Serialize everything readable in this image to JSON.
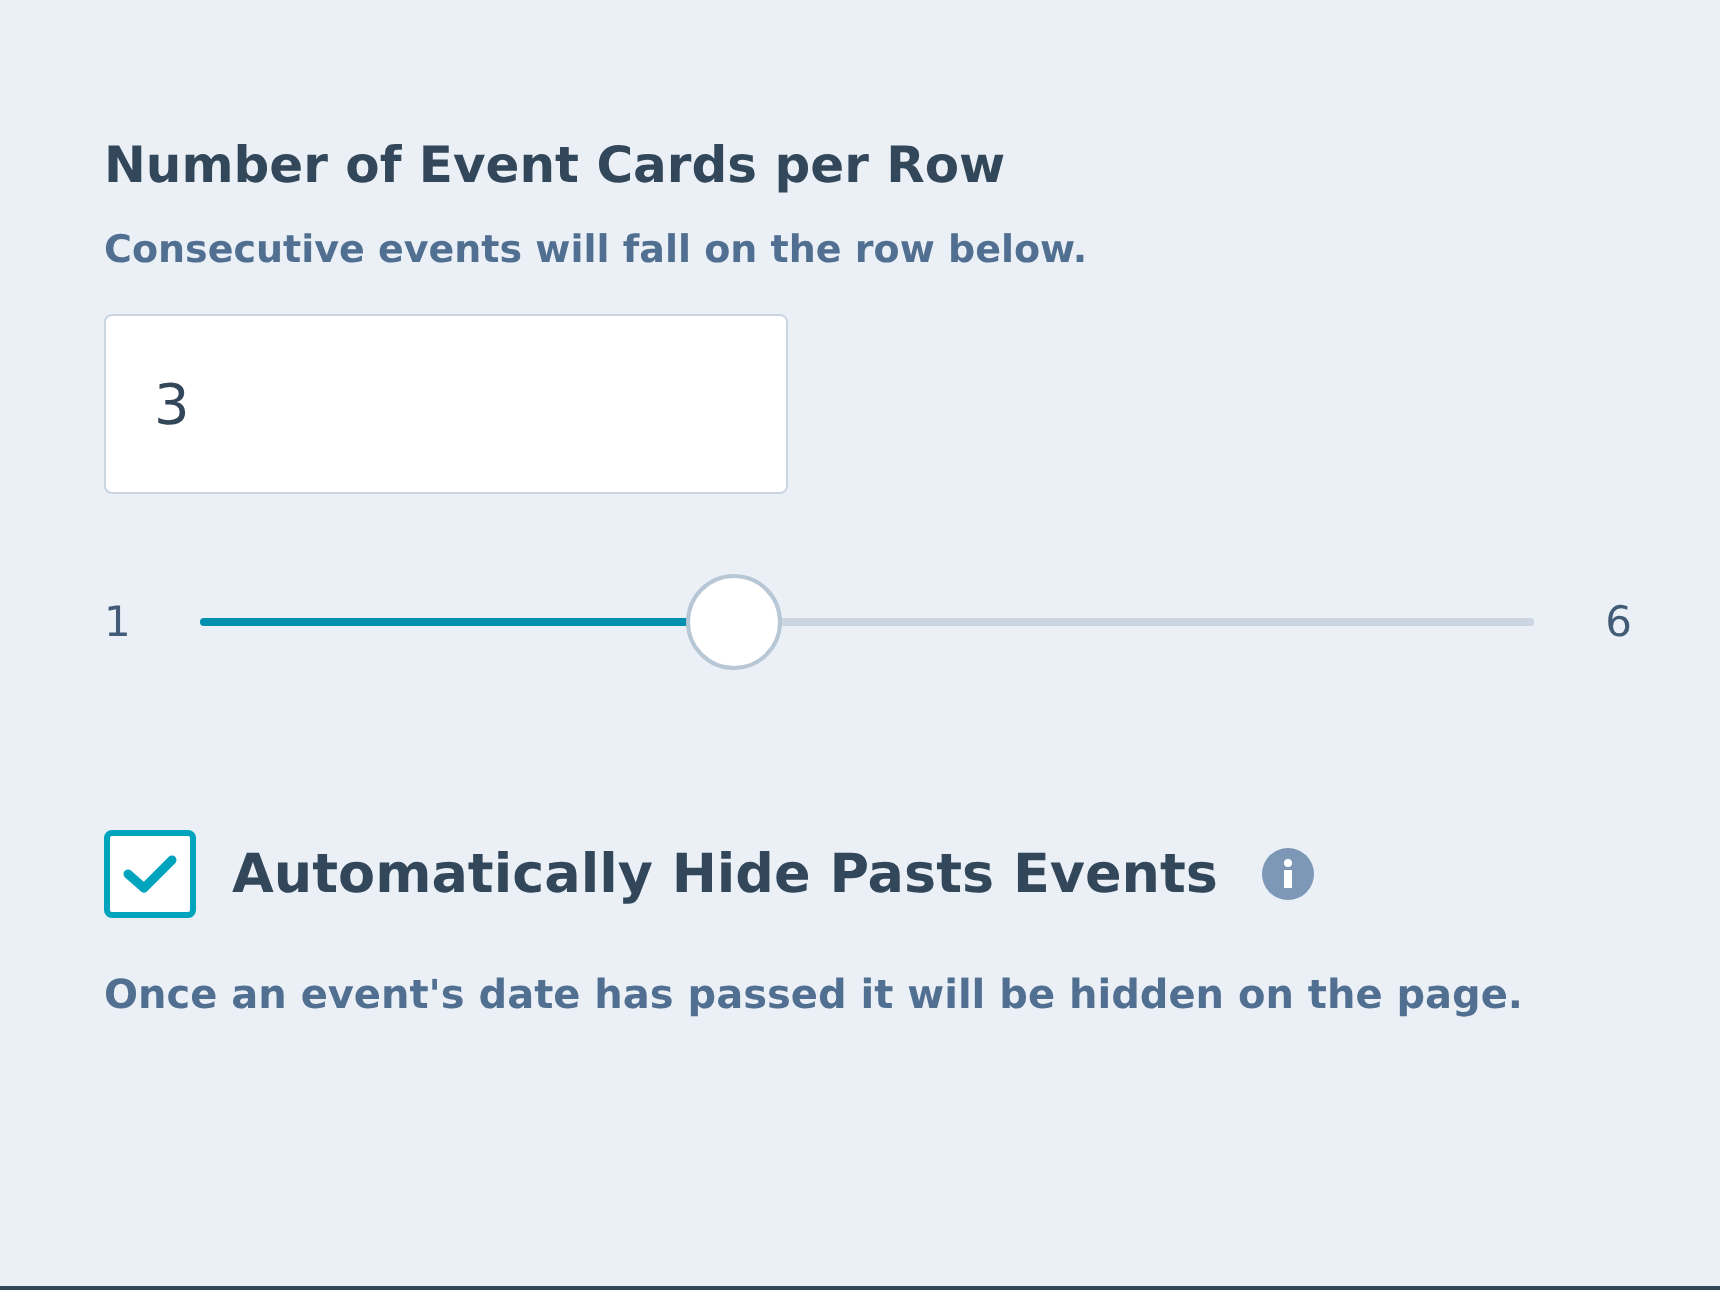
{
  "title": "Number of Event Cards per Row",
  "subtitle": "Consecutive events will fall on the row below.",
  "count_field": {
    "value": "3"
  },
  "slider": {
    "min_label": "1",
    "max_label": "6",
    "level": 0.4
  },
  "hide_past": {
    "label": "Automatically Hide Pasts Events",
    "checked": true,
    "description": "Once an event's date has passed it will be hidden on the page."
  }
}
